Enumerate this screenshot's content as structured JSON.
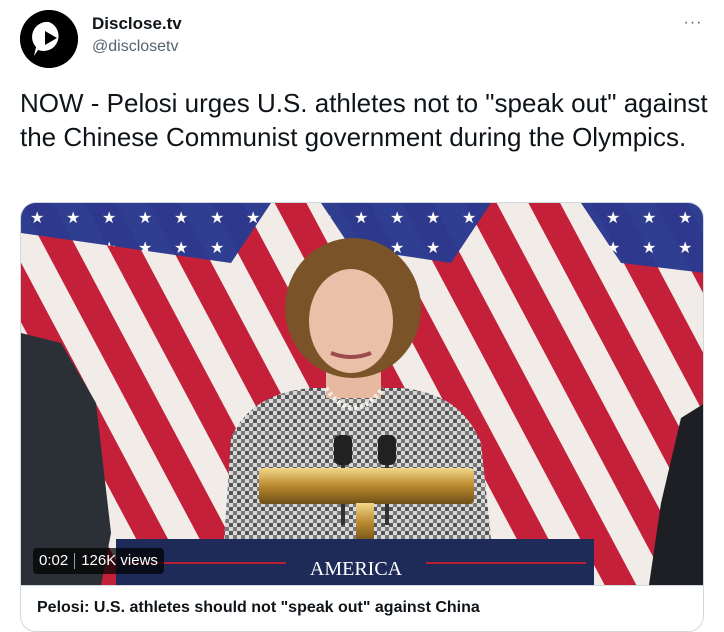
{
  "account": {
    "display_name": "Disclose.tv",
    "handle": "@disclosetv",
    "avatar_icon": "play-bubble-logo"
  },
  "menu": {
    "more_icon": "more-horizontal-icon",
    "more_label": "···"
  },
  "tweet": {
    "text": "NOW - Pelosi urges U.S. athletes not to \"speak out\" against the Chinese Communist government during the Olympics."
  },
  "video": {
    "elapsed": "0:02",
    "views": "126K views",
    "podium_text": "AMERICA"
  },
  "card": {
    "title": "Pelosi: U.S. athletes should not \"speak out\" against China"
  },
  "colors": {
    "flag_red": "#c4203a",
    "flag_blue": "#2b3a8f",
    "podium_navy": "#1e2a58",
    "text_primary": "#0f1419",
    "text_secondary": "#536471",
    "border": "#cfd9de"
  }
}
